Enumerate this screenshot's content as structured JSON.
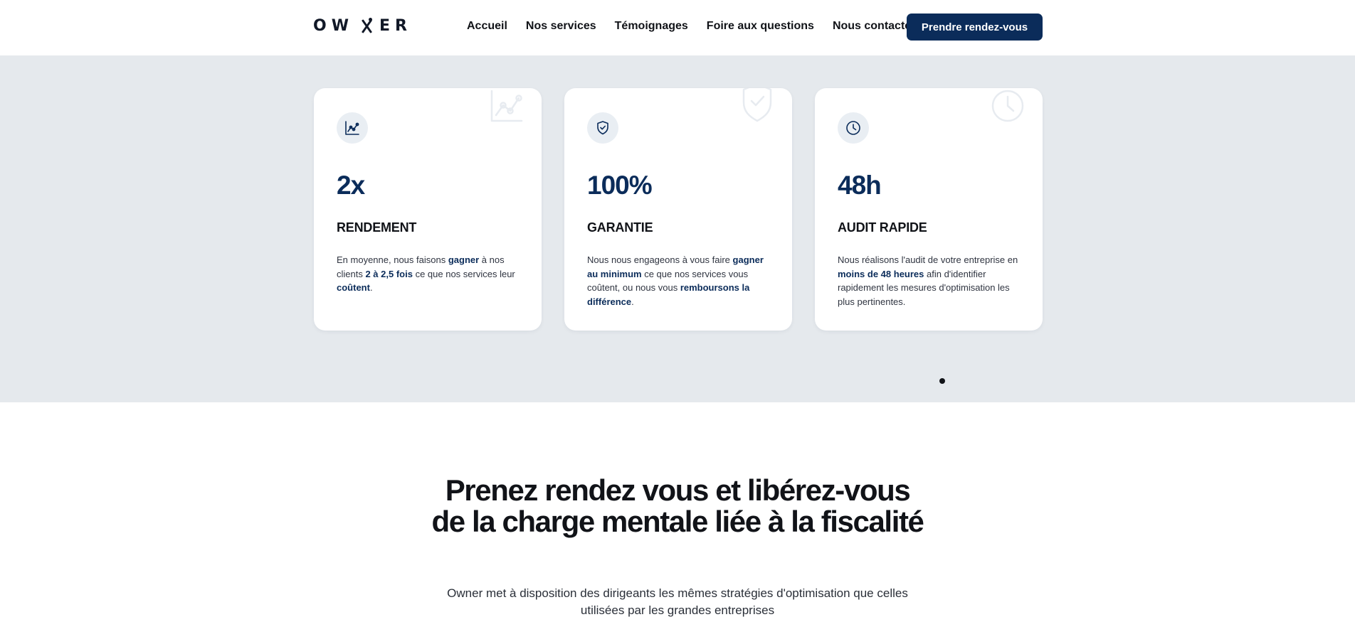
{
  "brand": {
    "logo_text_left": "OW",
    "logo_text_right": "ER"
  },
  "nav": {
    "items": [
      {
        "label": "Accueil"
      },
      {
        "label": "Nos services"
      },
      {
        "label": "Témoignages"
      },
      {
        "label": "Foire aux questions"
      },
      {
        "label": "Nous contacter"
      }
    ],
    "cta_label": "Prendre rendez-vous"
  },
  "colors": {
    "primary": "#0b2c5a",
    "band_bg": "#e5e9ed",
    "text": "#111318"
  },
  "stats": [
    {
      "icon": "chart-line-icon",
      "value": "2x",
      "title": "RENDEMENT",
      "desc": [
        {
          "t": "En moyenne, nous faisons ",
          "b": false
        },
        {
          "t": "gagner",
          "b": true
        },
        {
          "t": " à nos clients ",
          "b": false
        },
        {
          "t": "2 à 2,5 fois",
          "b": true
        },
        {
          "t": " ce que nos services leur ",
          "b": false
        },
        {
          "t": "coûtent",
          "b": true
        },
        {
          "t": ".",
          "b": false
        }
      ]
    },
    {
      "icon": "shield-check-icon",
      "value": "100%",
      "title": "GARANTIE",
      "desc": [
        {
          "t": "Nous nous engageons à vous faire ",
          "b": false
        },
        {
          "t": "gagner au minimum",
          "b": true
        },
        {
          "t": " ce que nos services vous coûtent, ou nous vous ",
          "b": false
        },
        {
          "t": "remboursons la différence",
          "b": true
        },
        {
          "t": ".",
          "b": false
        }
      ]
    },
    {
      "icon": "clock-icon",
      "value": "48h",
      "title": "AUDIT RAPIDE",
      "desc": [
        {
          "t": "Nous réalisons l'audit de votre entreprise en ",
          "b": false
        },
        {
          "t": "moins de 48 heures",
          "b": true
        },
        {
          "t": " afin d'identifier rapidement les mesures d'optimisation les plus pertinentes.",
          "b": false
        }
      ]
    }
  ],
  "carousel": {
    "active_index": 1,
    "total": 1
  },
  "cta_section": {
    "headline": "Prenez rendez vous et libérez-vous de la charge mentale liée à la fiscalité",
    "subtext": "Owner met à disposition des dirigeants les mêmes stratégies d'optimisation que celles utilisées par les grandes entreprises"
  }
}
